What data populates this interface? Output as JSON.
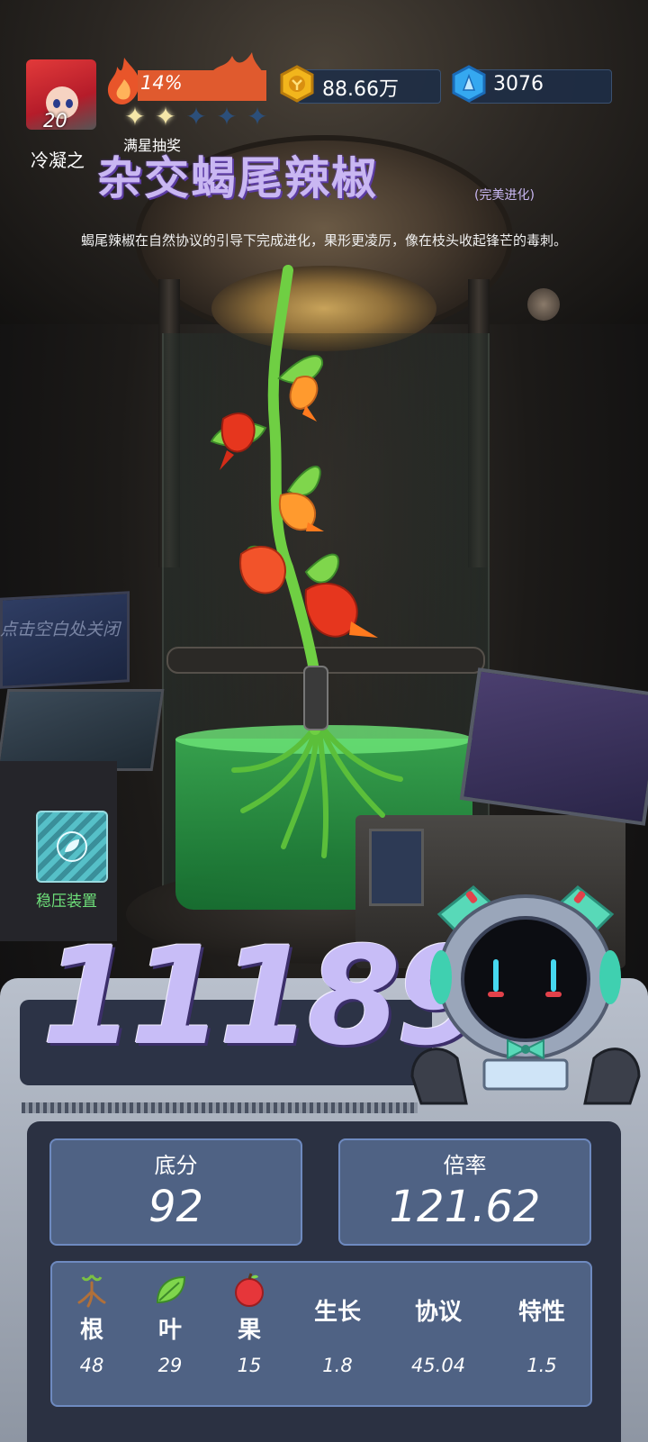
{
  "player": {
    "level": "20"
  },
  "hud": {
    "energy_percent_text": "14%",
    "energy_fraction": 0.14,
    "stars_filled": 2,
    "stars_total": 5,
    "subtitle": "满星抽奖",
    "gold": "88.66万",
    "gems": "3076"
  },
  "title": {
    "prefix": "冷凝之",
    "name": "杂交蝎尾辣椒",
    "tag": "(完美进化)",
    "description": "蝎尾辣椒在自然协议的引导下完成进化，果形更凌厉，像在枝头收起锋芒的毒刺。"
  },
  "hint": "点击空白处关闭",
  "stabilizer": {
    "label": "稳压装置"
  },
  "score": "11189",
  "stats": {
    "base": {
      "label": "底分",
      "value": "92"
    },
    "multiplier": {
      "label": "倍率",
      "value": "121.62"
    }
  },
  "attributes": [
    {
      "name": "根",
      "value": "48",
      "icon": "root-icon"
    },
    {
      "name": "叶",
      "value": "29",
      "icon": "leaf-icon"
    },
    {
      "name": "果",
      "value": "15",
      "icon": "fruit-icon"
    },
    {
      "name": "生长",
      "value": "1.8"
    },
    {
      "name": "协议",
      "value": "45.04"
    },
    {
      "name": "特性",
      "value": "1.5"
    }
  ],
  "colors": {
    "energy_bar": "#e05a2e",
    "title": "#c9b7f2",
    "panel": "#4f6284",
    "stabilizer_label": "#6ee07a"
  }
}
